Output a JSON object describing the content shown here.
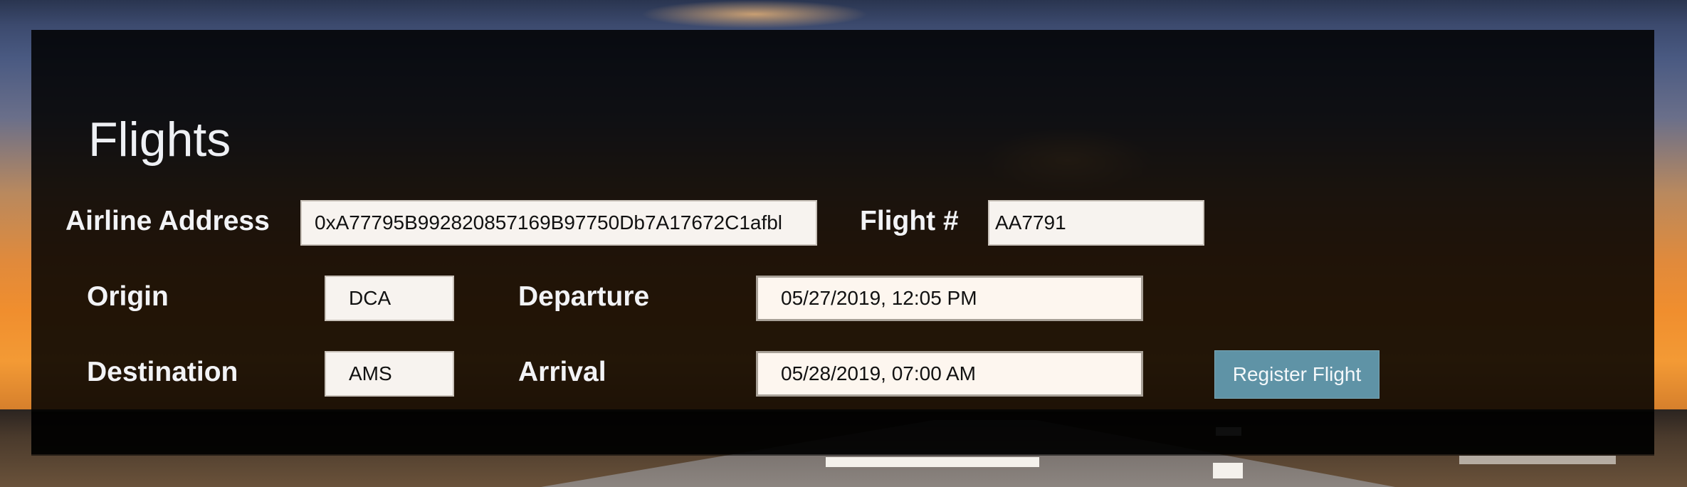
{
  "page": {
    "title": "Flights"
  },
  "form": {
    "airline_address_label": "Airline Address",
    "airline_address_value": "0xA77795B992820857169B97750Db7A17672C1afbl",
    "flight_number_label": "Flight #",
    "flight_number_value": "AA7791",
    "origin_label": "Origin",
    "origin_value": "DCA",
    "departure_label": "Departure",
    "departure_value": "05/27/2019, 12:05 PM",
    "destination_label": "Destination",
    "destination_value": "AMS",
    "arrival_label": "Arrival",
    "arrival_value": "05/28/2019, 07:00 AM",
    "register_button_label": "Register Flight"
  },
  "colors": {
    "button": "#5f93a6",
    "panel": "#000000"
  }
}
